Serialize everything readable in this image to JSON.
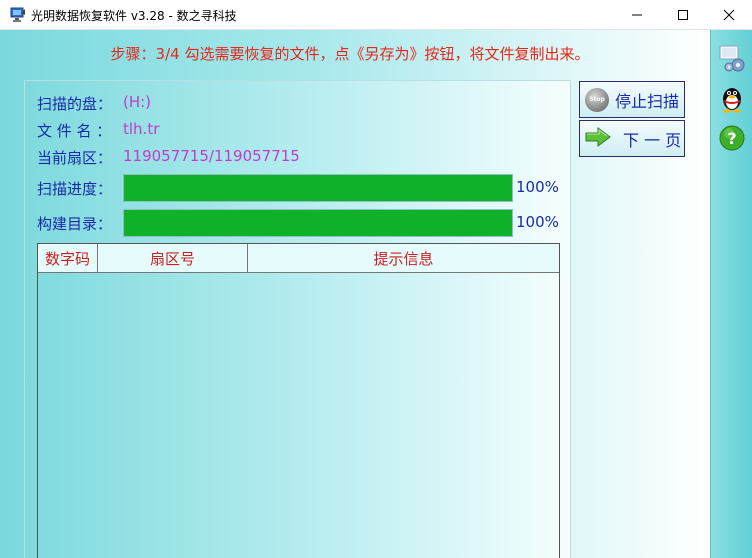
{
  "window": {
    "title": "光明数据恢复软件 v3.28 - 数之寻科技",
    "min_glyph": "─",
    "max_glyph": "☐",
    "close_glyph": "✕"
  },
  "step_text": "步骤：3/4 勾选需要恢复的文件，点《另存为》按钮，将文件复制出来。",
  "info": {
    "disk_label": "扫描的盘：",
    "disk_value": "(H:)",
    "file_label": "文 件 名 ：",
    "file_value": "tlh.tr",
    "sector_label": "当前扇区：",
    "sector_value": "119057715/119057715",
    "scan_label": "扫描进度：",
    "scan_percent": "100%",
    "scan_fraction": 1.0,
    "build_label": "构建目录：",
    "build_percent": "100%",
    "build_fraction": 1.0
  },
  "table": {
    "columns": [
      "数字码",
      "扇区号",
      "提示信息"
    ],
    "rows": []
  },
  "buttons": {
    "stop_label": "停止扫描",
    "stop_icon_text": "Stop",
    "next_label": "下 一 页"
  },
  "colors": {
    "step_text": "#e8271b",
    "label_blue": "#1a2aa8",
    "value_magenta": "#c23cc9",
    "progress_green": "#0fb12a",
    "header_red": "#cc2020"
  },
  "icons": {
    "sidebar": [
      "settings-gears-icon",
      "qq-penguin-icon",
      "help-question-icon"
    ],
    "next_button": "green-arrow-right-icon",
    "stop_button": "stop-circle-icon"
  }
}
